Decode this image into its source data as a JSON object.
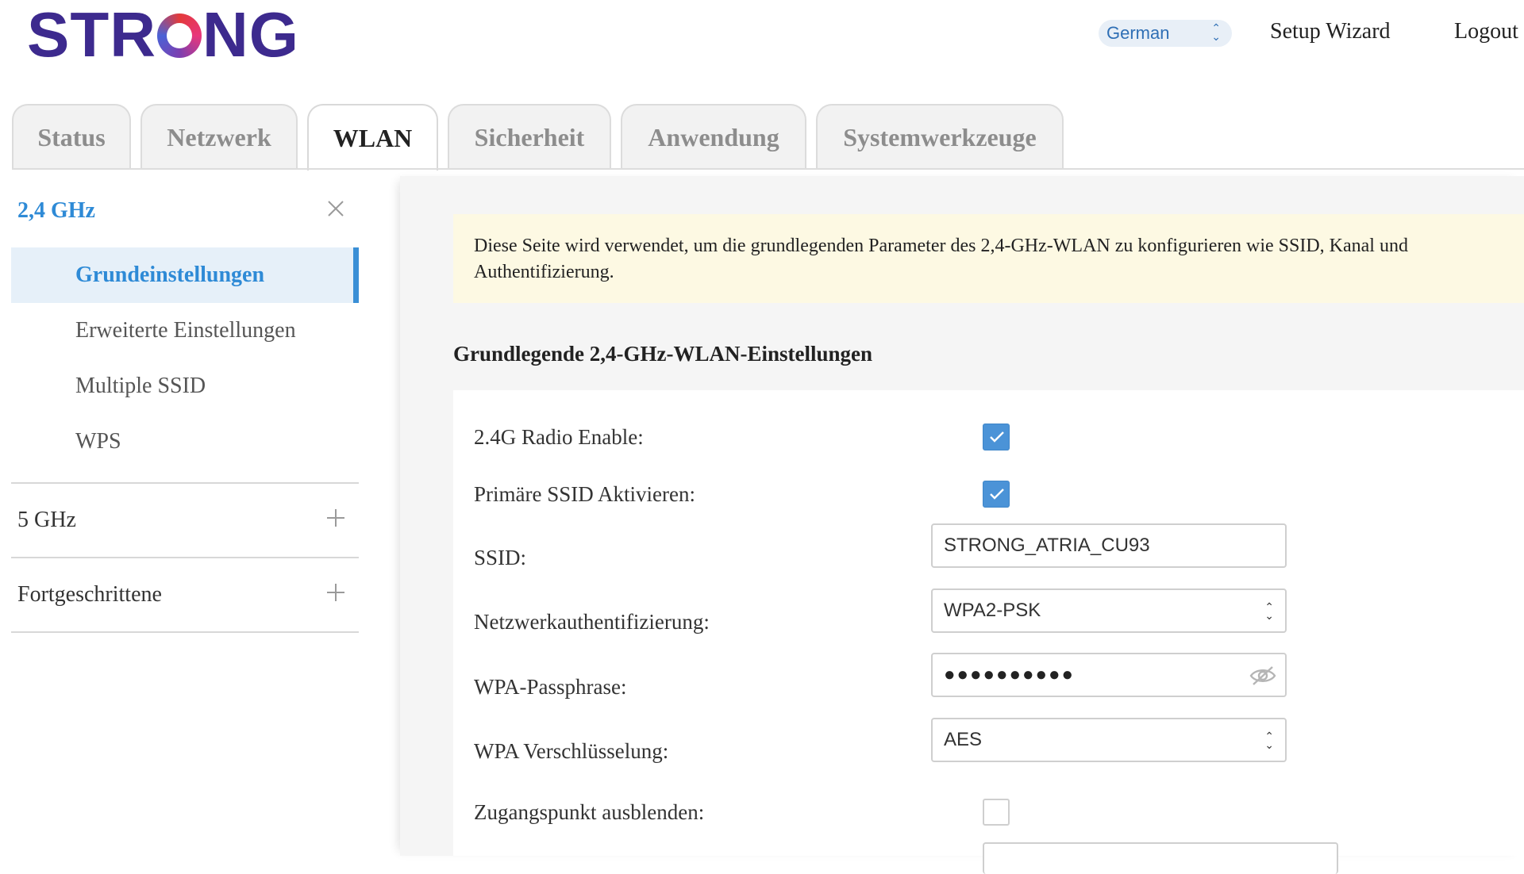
{
  "header": {
    "logo_text": "STRONG",
    "language": {
      "selected": "German"
    },
    "setup_wizard_label": "Setup Wizard",
    "logout_label": "Logout"
  },
  "tabs": [
    {
      "label": "Status",
      "active": false
    },
    {
      "label": "Netzwerk",
      "active": false
    },
    {
      "label": "WLAN",
      "active": true
    },
    {
      "label": "Sicherheit",
      "active": false
    },
    {
      "label": "Anwendung",
      "active": false
    },
    {
      "label": "Systemwerkzeuge",
      "active": false
    }
  ],
  "sidebar": {
    "group_24": {
      "label": "2,4 GHz",
      "expanded": true,
      "items": [
        {
          "label": "Grundeinstellungen",
          "active": true
        },
        {
          "label": "Erweiterte Einstellungen",
          "active": false
        },
        {
          "label": "Multiple SSID",
          "active": false
        },
        {
          "label": "WPS",
          "active": false
        }
      ]
    },
    "group_5": {
      "label": "5 GHz",
      "expanded": false
    },
    "group_adv": {
      "label": "Fortgeschrittene",
      "expanded": false
    }
  },
  "main": {
    "notice": "Diese Seite wird verwendet, um die grundlegenden Parameter des 2,4-GHz-WLAN zu konfigurieren wie SSID, Kanal und Authentifizierung.",
    "section_title": "Grundlegende 2,4-GHz-WLAN-Einstellungen",
    "form": {
      "radio_enable": {
        "label": "2.4G Radio Enable:",
        "checked": true
      },
      "primary_ssid": {
        "label": "Primäre SSID Aktivieren:",
        "checked": true
      },
      "ssid": {
        "label": "SSID:",
        "value": "STRONG_ATRIA_CU93"
      },
      "auth": {
        "label": "Netzwerkauthentifizierung:",
        "value": "WPA2-PSK"
      },
      "passphrase": {
        "label": "WPA-Passphrase:",
        "value": "●●●●●●●●●●"
      },
      "encryption": {
        "label": "WPA Verschlüsselung:",
        "value": "AES"
      },
      "hide_ap": {
        "label": "Zugangspunkt ausblenden:",
        "checked": false
      }
    }
  },
  "colors": {
    "accent": "#2e8ad6",
    "logo": "#3d2a8e",
    "notice_bg": "#fdf9e3",
    "checkbox": "#4b93d7"
  }
}
